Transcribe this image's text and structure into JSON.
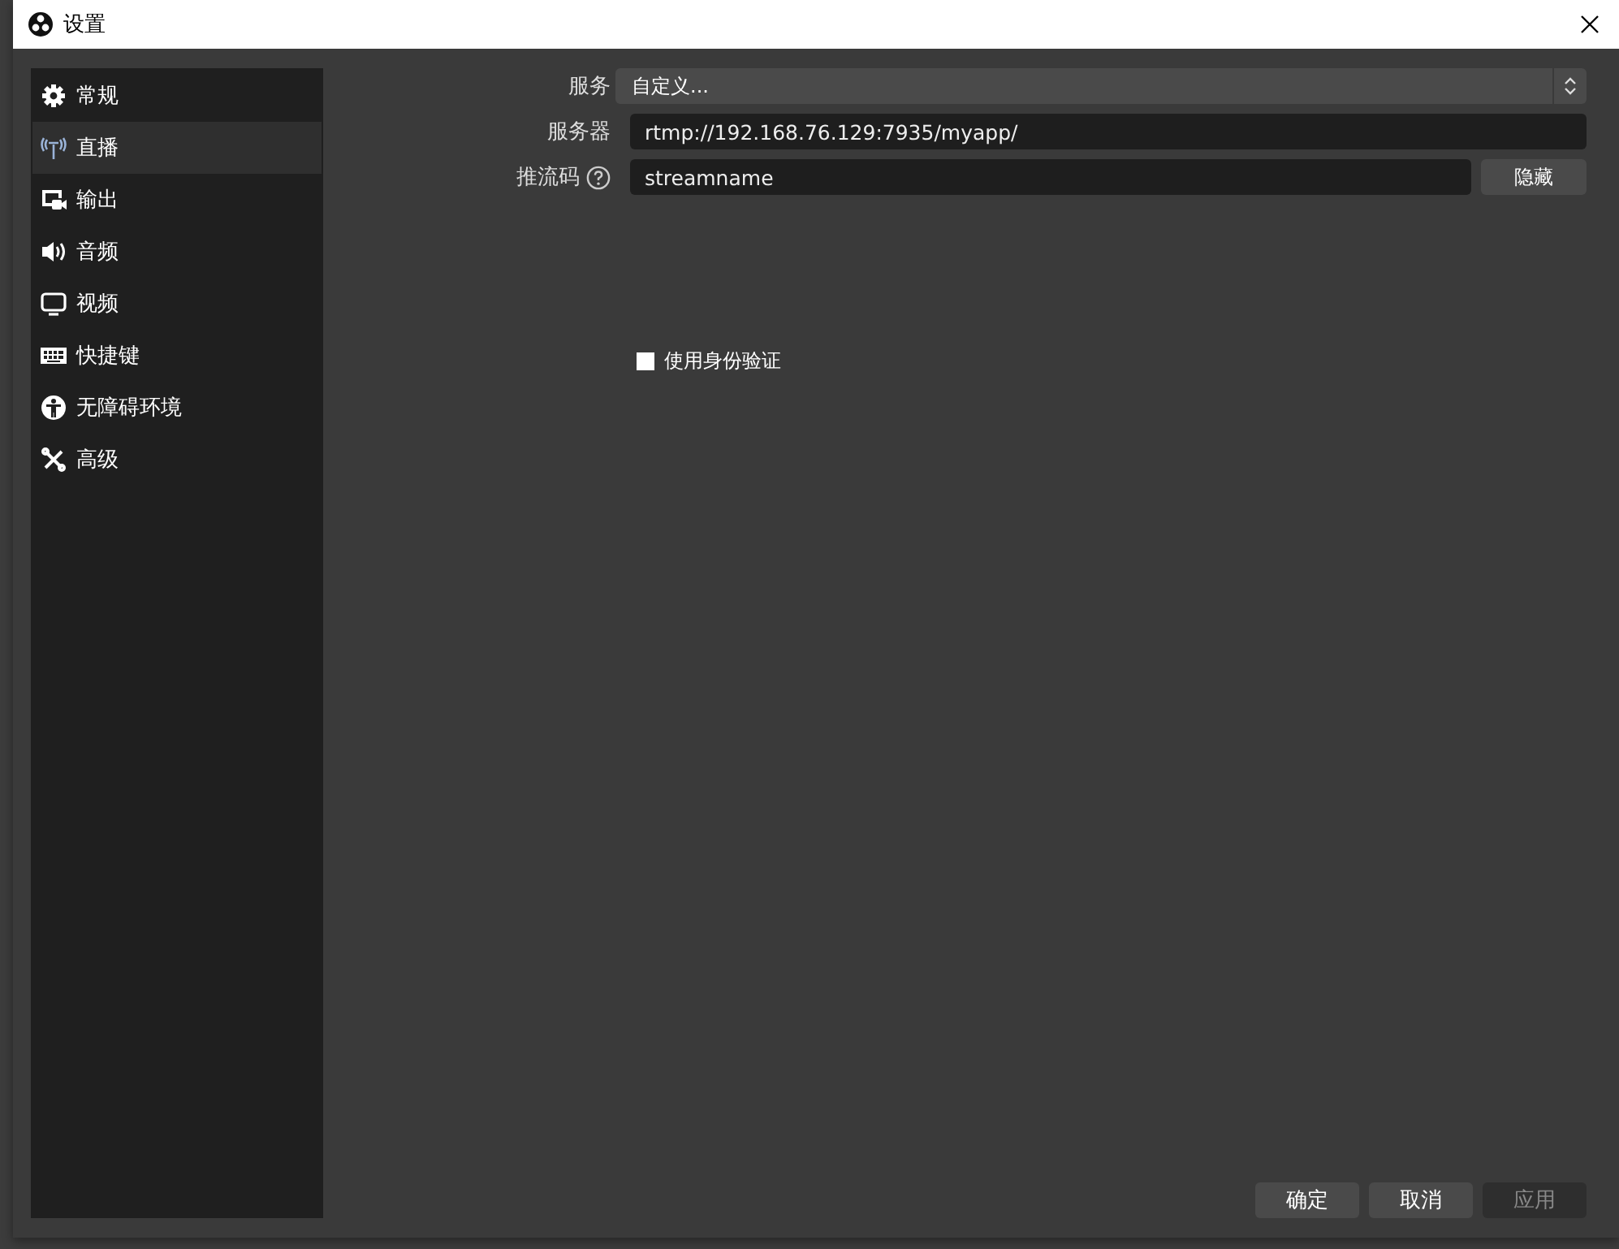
{
  "window": {
    "title": "设置"
  },
  "sidebar": {
    "items": [
      {
        "label": "常规",
        "selected": false
      },
      {
        "label": "直播",
        "selected": true
      },
      {
        "label": "输出",
        "selected": false
      },
      {
        "label": "音频",
        "selected": false
      },
      {
        "label": "视频",
        "selected": false
      },
      {
        "label": "快捷键",
        "selected": false
      },
      {
        "label": "无障碍环境",
        "selected": false
      },
      {
        "label": "高级",
        "selected": false
      }
    ]
  },
  "form": {
    "service": {
      "label": "服务",
      "value": "自定义..."
    },
    "server": {
      "label": "服务器",
      "value": "rtmp://192.168.76.129:7935/myapp/"
    },
    "stream_key": {
      "label": "推流码",
      "value": "streamname",
      "button": "隐藏"
    },
    "auth": {
      "label": "使用身份验证",
      "checked": false
    }
  },
  "buttons": [
    {
      "label": "确定",
      "disabled": false
    },
    {
      "label": "取消",
      "disabled": false
    },
    {
      "label": "应用",
      "disabled": true
    }
  ]
}
